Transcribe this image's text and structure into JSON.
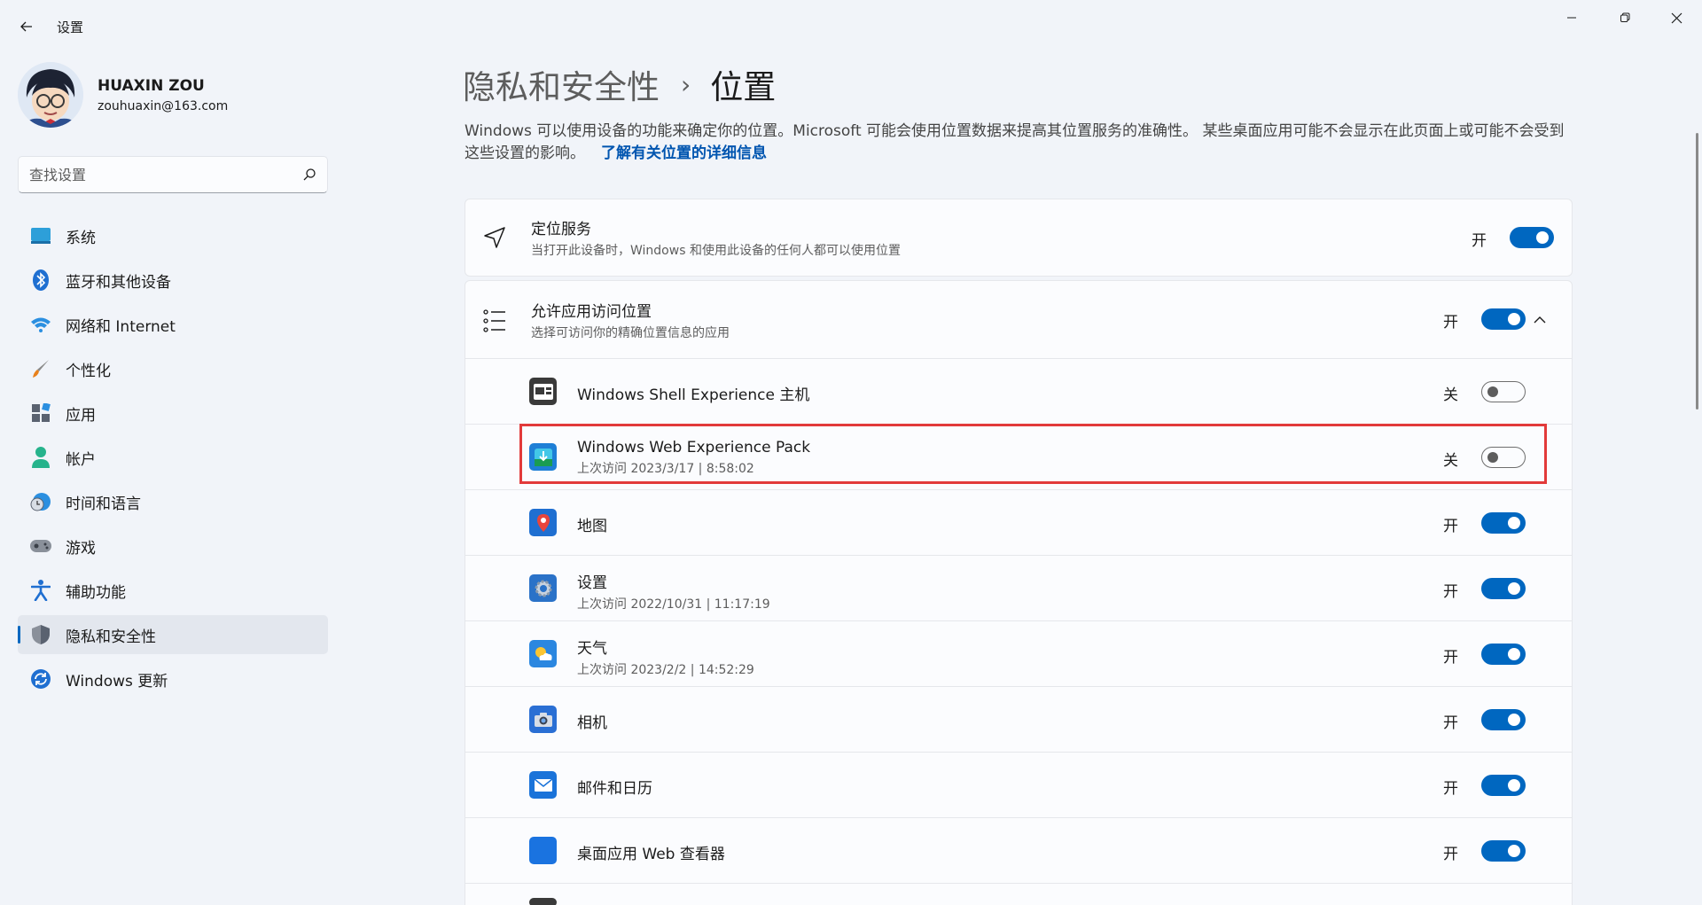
{
  "window": {
    "title": "设置"
  },
  "profile": {
    "name": "HUAXIN ZOU",
    "email": "zouhuaxin@163.com"
  },
  "search": {
    "placeholder": "查找设置"
  },
  "nav": {
    "items": [
      {
        "label": "系统",
        "icon": "system-icon"
      },
      {
        "label": "蓝牙和其他设备",
        "icon": "bluetooth-icon"
      },
      {
        "label": "网络和 Internet",
        "icon": "wifi-icon"
      },
      {
        "label": "个性化",
        "icon": "brush-icon"
      },
      {
        "label": "应用",
        "icon": "apps-icon"
      },
      {
        "label": "帐户",
        "icon": "account-icon"
      },
      {
        "label": "时间和语言",
        "icon": "clock-globe-icon"
      },
      {
        "label": "游戏",
        "icon": "gamepad-icon"
      },
      {
        "label": "辅助功能",
        "icon": "accessibility-icon"
      },
      {
        "label": "隐私和安全性",
        "icon": "shield-icon",
        "active": true
      },
      {
        "label": "Windows 更新",
        "icon": "update-icon"
      }
    ]
  },
  "breadcrumb": {
    "parent": "隐私和安全性",
    "separator": "›",
    "current": "位置"
  },
  "description": {
    "text": "Windows 可以使用设备的功能来确定你的位置。Microsoft 可能会使用位置数据来提高其位置服务的准确性。 某些桌面应用可能不会显示在此页面上或可能不会受到这些设置的影响。",
    "link": "了解有关位置的详细信息"
  },
  "location_service": {
    "title": "定位服务",
    "subtitle": "当打开此设备时，Windows 和使用此设备的任何人都可以使用位置",
    "state": "开",
    "on": true
  },
  "app_access": {
    "title": "允许应用访问位置",
    "subtitle": "选择可访问你的精确位置信息的应用",
    "state": "开",
    "on": true,
    "apps": [
      {
        "name": "Windows Shell Experience 主机",
        "sub": "",
        "state": "关",
        "on": false,
        "icon": "shell-experience-icon",
        "color": "#3a3a3a"
      },
      {
        "name": "Windows Web Experience Pack",
        "sub": "上次访问 2023/3/17 | 8:58:02",
        "state": "关",
        "on": false,
        "icon": "web-experience-icon",
        "color": "#1e7fd6",
        "highlighted": true
      },
      {
        "name": "地图",
        "sub": "",
        "state": "开",
        "on": true,
        "icon": "maps-icon",
        "color": "#1f6fd1"
      },
      {
        "name": "设置",
        "sub": "上次访问 2022/10/31 | 11:17:19",
        "state": "开",
        "on": true,
        "icon": "settings-gear-icon",
        "color": "#2a72c8"
      },
      {
        "name": "天气",
        "sub": "上次访问 2023/2/2 | 14:52:29",
        "state": "开",
        "on": true,
        "icon": "weather-icon",
        "color": "#2b87e0"
      },
      {
        "name": "相机",
        "sub": "",
        "state": "开",
        "on": true,
        "icon": "camera-icon",
        "color": "#2a6fd4"
      },
      {
        "name": "邮件和日历",
        "sub": "",
        "state": "开",
        "on": true,
        "icon": "mail-icon",
        "color": "#1a73d9"
      },
      {
        "name": "桌面应用 Web 查看器",
        "sub": "",
        "state": "开",
        "on": true,
        "icon": "web-viewer-icon",
        "color": "#1a73e0"
      }
    ]
  },
  "colors": {
    "accent": "#0067c0",
    "highlight_box": "#e23a3a",
    "background": "#f1f4f9",
    "card": "#fbfcfe"
  }
}
